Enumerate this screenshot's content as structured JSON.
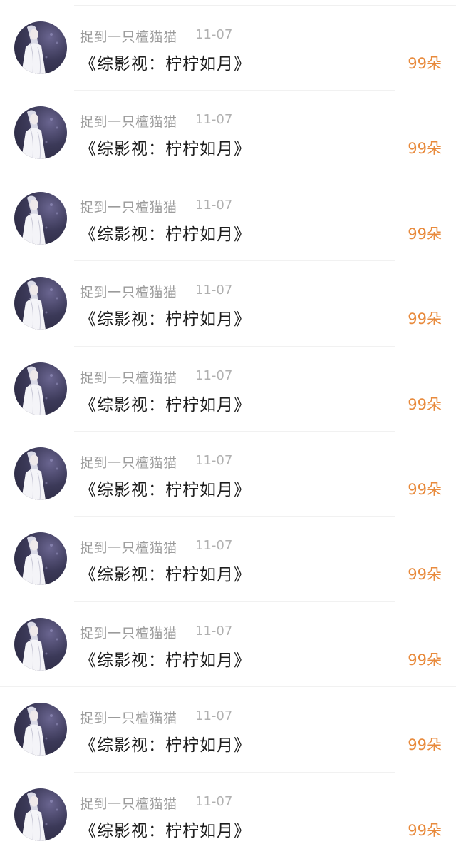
{
  "list": {
    "items": [
      {
        "username": "捉到一只檀猫猫",
        "date": "11-07",
        "title": "《综影视：柠柠如月》",
        "gift": "99朵",
        "avatar_icon": "avatar-icon"
      },
      {
        "username": "捉到一只檀猫猫",
        "date": "11-07",
        "title": "《综影视：柠柠如月》",
        "gift": "99朵",
        "avatar_icon": "avatar-icon"
      },
      {
        "username": "捉到一只檀猫猫",
        "date": "11-07",
        "title": "《综影视：柠柠如月》",
        "gift": "99朵",
        "avatar_icon": "avatar-icon"
      },
      {
        "username": "捉到一只檀猫猫",
        "date": "11-07",
        "title": "《综影视：柠柠如月》",
        "gift": "99朵",
        "avatar_icon": "avatar-icon"
      },
      {
        "username": "捉到一只檀猫猫",
        "date": "11-07",
        "title": "《综影视：柠柠如月》",
        "gift": "99朵",
        "avatar_icon": "avatar-icon"
      },
      {
        "username": "捉到一只檀猫猫",
        "date": "11-07",
        "title": "《综影视：柠柠如月》",
        "gift": "99朵",
        "avatar_icon": "avatar-icon"
      },
      {
        "username": "捉到一只檀猫猫",
        "date": "11-07",
        "title": "《综影视：柠柠如月》",
        "gift": "99朵",
        "avatar_icon": "avatar-icon"
      },
      {
        "username": "捉到一只檀猫猫",
        "date": "11-07",
        "title": "《综影视：柠柠如月》",
        "gift": "99朵",
        "avatar_icon": "avatar-icon"
      },
      {
        "username": "捉到一只檀猫猫",
        "date": "11-07",
        "title": "《综影视：柠柠如月》",
        "gift": "99朵",
        "avatar_icon": "avatar-icon"
      },
      {
        "username": "捉到一只檀猫猫",
        "date": "11-07",
        "title": "《综影视：柠柠如月》",
        "gift": "99朵",
        "avatar_icon": "avatar-icon"
      }
    ]
  },
  "colors": {
    "gift_accent": "#e88a3c",
    "username": "#9b9b9b",
    "date": "#b0b0b0",
    "title": "#1d1d1d"
  }
}
